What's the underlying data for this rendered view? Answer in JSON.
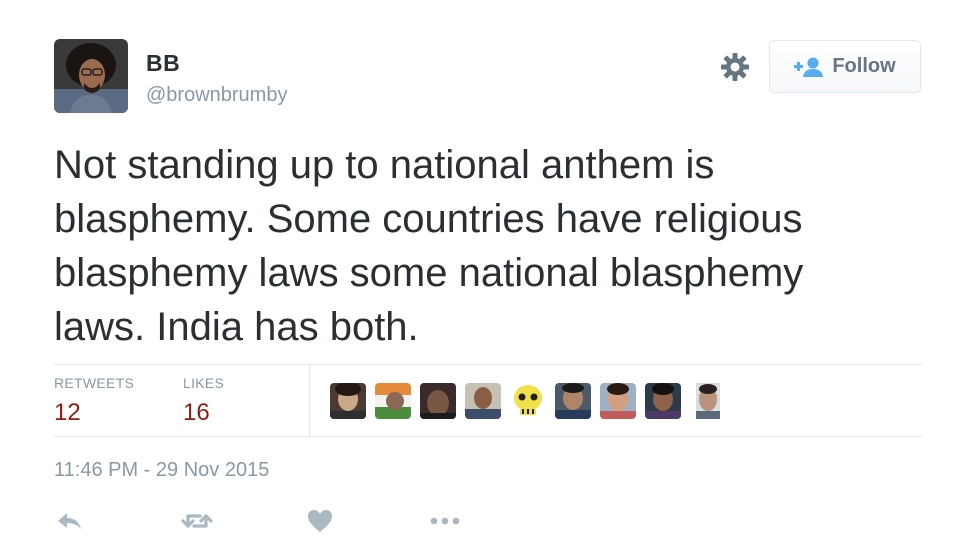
{
  "user": {
    "display_name": "BB",
    "handle": "@brownbrumby"
  },
  "follow_button": {
    "label": "Follow"
  },
  "tweet": {
    "text": "Not standing up to national anthem is\nblasphemy. Some countries have religious\nblasphemy laws some national blasphemy\nlaws. India has both."
  },
  "stats": {
    "retweets_label": "RETWEETS",
    "retweets_value": "12",
    "likes_label": "LIKES",
    "likes_value": "16"
  },
  "likers_count_shown": 9,
  "timestamp": "11:46 PM - 29 Nov 2015",
  "colors": {
    "stat_value": "#8b1e12",
    "muted": "#8899a6",
    "text": "#292f33",
    "follow_icon": "#55acee"
  },
  "icons": {
    "settings": "gear-icon",
    "follow": "add-person-icon",
    "reply": "reply-icon",
    "retweet": "retweet-icon",
    "like": "heart-icon",
    "more": "more-dots-icon"
  }
}
